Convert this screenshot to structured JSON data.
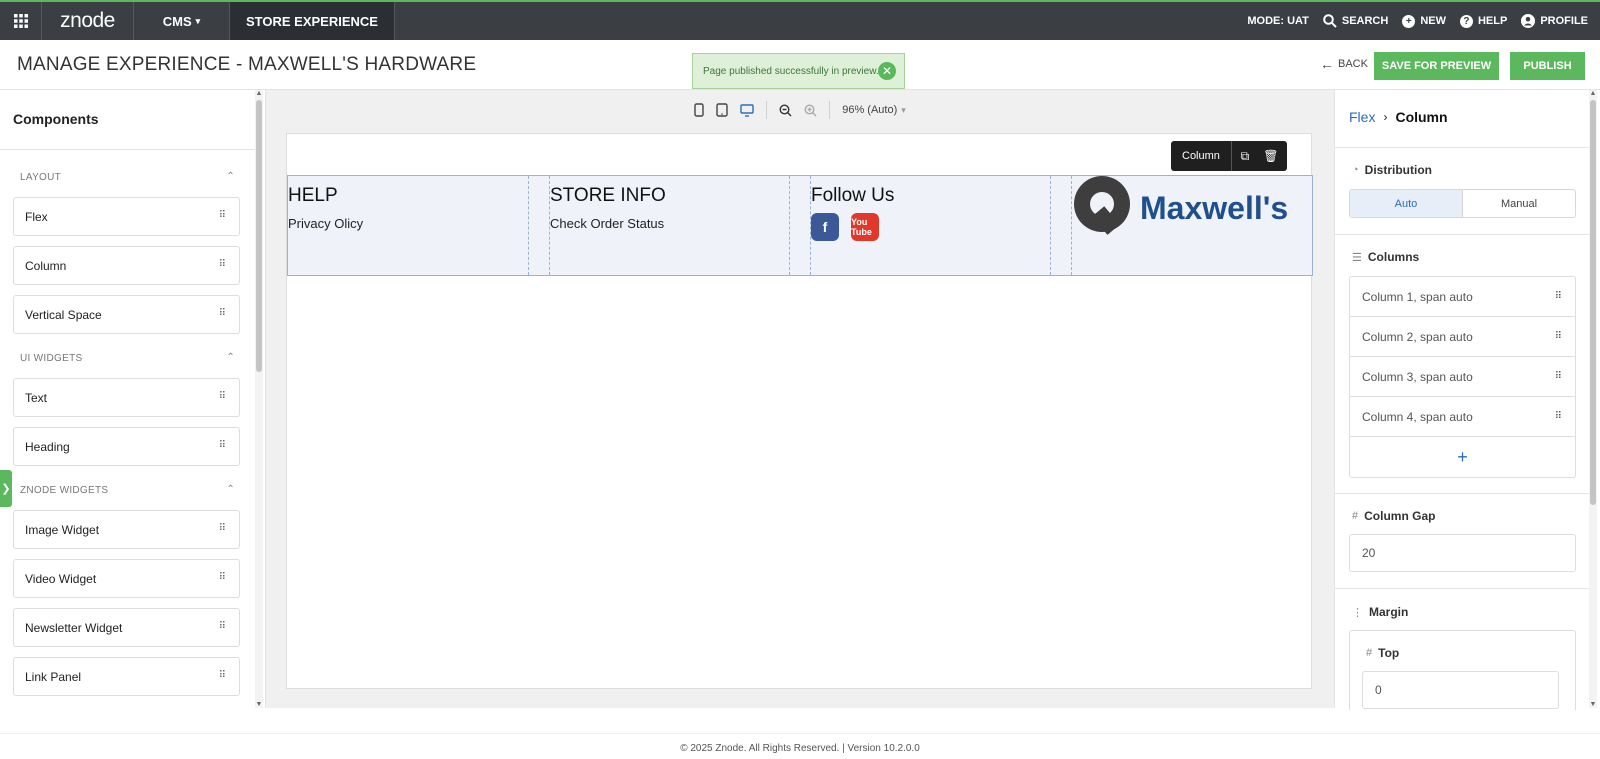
{
  "topnav": {
    "logo": "znode",
    "cms": "CMS",
    "store_experience": "STORE EXPERIENCE",
    "mode": "MODE: UAT",
    "search": "SEARCH",
    "new": "NEW",
    "help": "HELP",
    "profile": "PROFILE"
  },
  "header": {
    "title": "MANAGE EXPERIENCE  -  MAXWELL'S HARDWARE",
    "toast": "Page published successfully in preview.",
    "back": "BACK",
    "save_preview": "SAVE FOR PREVIEW",
    "publish": "PUBLISH"
  },
  "left": {
    "title": "Components",
    "sections": [
      {
        "label": "LAYOUT",
        "items": [
          "Flex",
          "Column",
          "Vertical Space"
        ]
      },
      {
        "label": "UI WIDGETS",
        "items": [
          "Text",
          "Heading"
        ]
      },
      {
        "label": "ZNODE WIDGETS",
        "items": [
          "Image Widget",
          "Video Widget",
          "Newsletter Widget",
          "Link Panel"
        ]
      }
    ]
  },
  "canvas": {
    "zoom": "96% (Auto)",
    "badge": "Column",
    "columns": [
      {
        "heading": "HELP",
        "text": "Privacy Olicy"
      },
      {
        "heading": "STORE INFO",
        "text": "Check Order Status"
      },
      {
        "heading": "Follow Us",
        "text": ""
      },
      {
        "logo_text": "Maxwell's"
      }
    ],
    "social": {
      "facebook": "f",
      "youtube": "You Tube"
    }
  },
  "right": {
    "crumb_parent": "Flex",
    "crumb_current": "Column",
    "distribution_label": "Distribution",
    "dist_auto": "Auto",
    "dist_manual": "Manual",
    "columns_label": "Columns",
    "columns": [
      "Column 1, span auto",
      "Column 2, span auto",
      "Column 3, span auto",
      "Column 4, span auto"
    ],
    "add": "+",
    "gap_label": "Column Gap",
    "gap_value": "20",
    "margin_label": "Margin",
    "top_label": "Top",
    "top_value": "0"
  },
  "footer": "© 2025 Znode. All Rights Reserved. | Version 10.2.0.0",
  "colors": {
    "accent_green": "#5cb85c",
    "topbar": "#3b3f44",
    "link_blue": "#2a6ebb"
  }
}
